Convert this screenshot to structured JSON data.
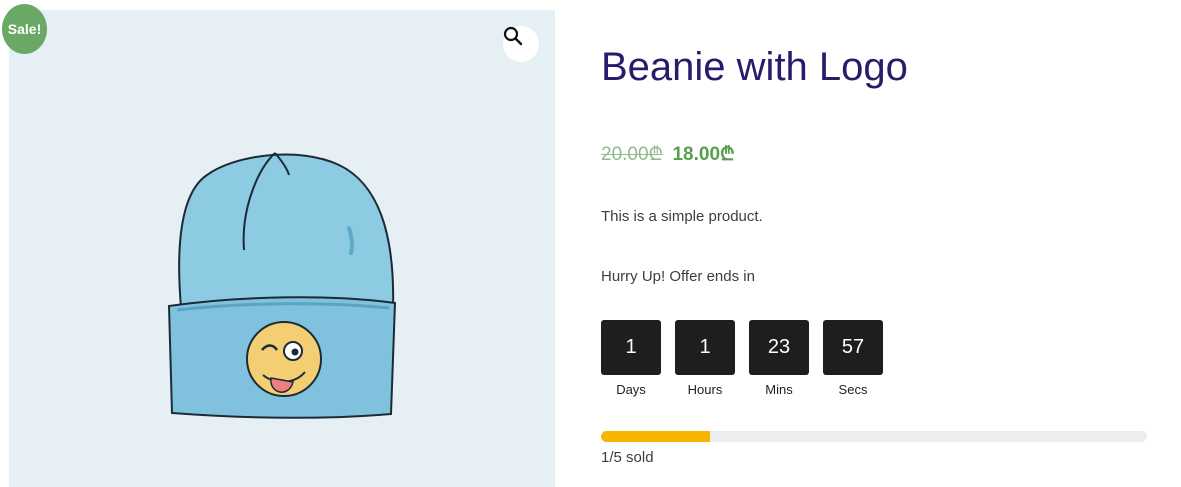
{
  "product": {
    "title": "Beanie with Logo",
    "sale_badge": "Sale!",
    "regular_price": "20.00₾",
    "sale_price": "18.00₾",
    "description": "This is a simple product.",
    "offer_text": "Hurry Up! Offer ends in",
    "image_icon": "beanie-with-winking-emoji",
    "zoom_icon": "magnifier-icon"
  },
  "countdown": [
    {
      "value": "1",
      "label": "Days"
    },
    {
      "value": "1",
      "label": "Hours"
    },
    {
      "value": "23",
      "label": "Mins"
    },
    {
      "value": "57",
      "label": "Secs"
    }
  ],
  "stock": {
    "sold_text": "1/5 sold",
    "sold_fraction": 0.2
  },
  "colors": {
    "title": "#2c1a6b",
    "sale_price": "#58a04d",
    "badge": "#6aa865",
    "progress": "#f7b500",
    "countdown_box": "#1e1e1e"
  }
}
